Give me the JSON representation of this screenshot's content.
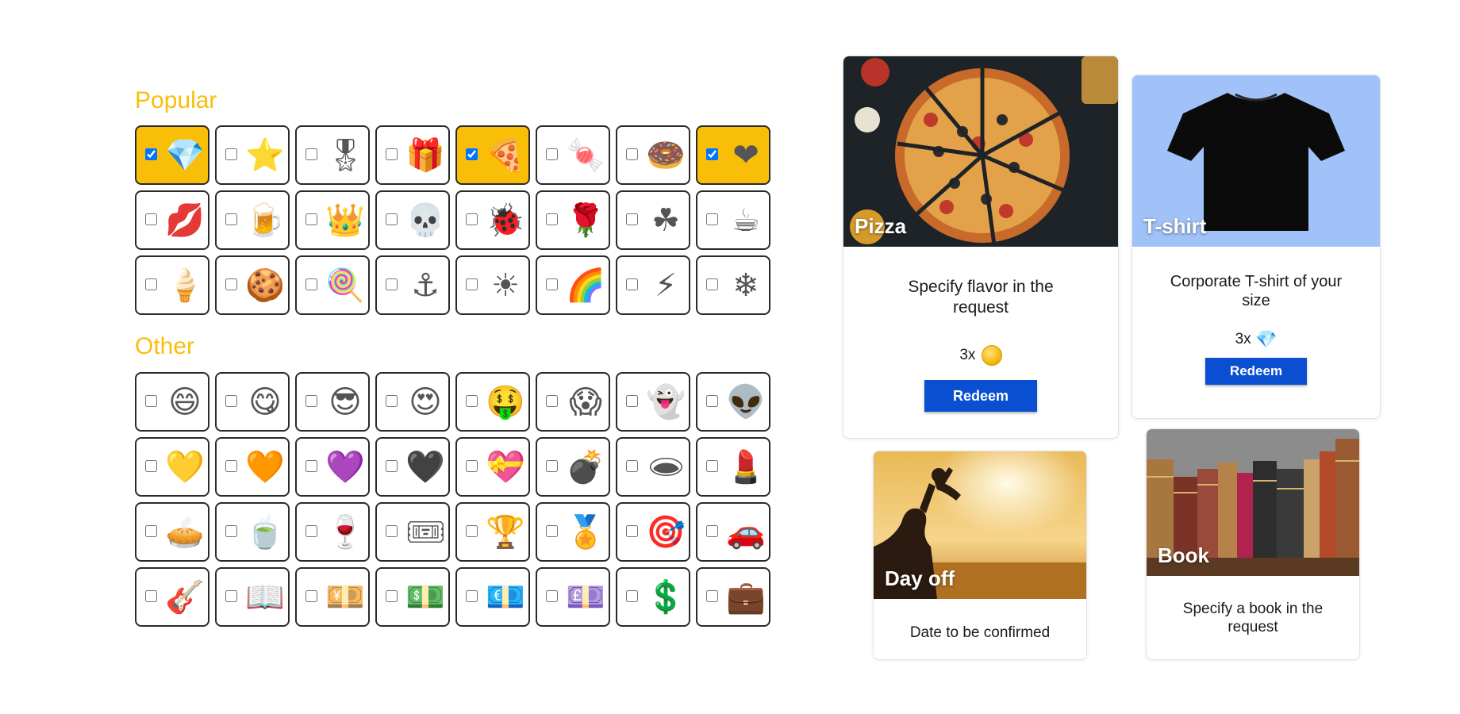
{
  "sections": {
    "popular_title": "Popular",
    "other_title": "Other"
  },
  "popular": [
    {
      "icon": "diamond-icon",
      "glyph": "💎",
      "checked": true
    },
    {
      "icon": "star-icon",
      "glyph": "⭐",
      "checked": false
    },
    {
      "icon": "medal-icon",
      "glyph": "🎖",
      "checked": false
    },
    {
      "icon": "gift-icon",
      "glyph": "🎁",
      "checked": false
    },
    {
      "icon": "pizza-icon",
      "glyph": "🍕",
      "checked": true
    },
    {
      "icon": "candy-icon",
      "glyph": "🍬",
      "checked": false
    },
    {
      "icon": "donut-icon",
      "glyph": "🍩",
      "checked": false
    },
    {
      "icon": "heart-icon",
      "glyph": "❤",
      "checked": true
    },
    {
      "icon": "kiss-icon",
      "glyph": "💋",
      "checked": false
    },
    {
      "icon": "beer-icon",
      "glyph": "🍺",
      "checked": false
    },
    {
      "icon": "crown-icon",
      "glyph": "👑",
      "checked": false
    },
    {
      "icon": "skull-icon",
      "glyph": "💀",
      "checked": false
    },
    {
      "icon": "ladybug-icon",
      "glyph": "🐞",
      "checked": false
    },
    {
      "icon": "rose-icon",
      "glyph": "🌹",
      "checked": false
    },
    {
      "icon": "shamrock-icon",
      "glyph": "☘",
      "checked": false
    },
    {
      "icon": "coffee-icon",
      "glyph": "☕",
      "checked": false
    },
    {
      "icon": "ice-cream-icon",
      "glyph": "🍦",
      "checked": false
    },
    {
      "icon": "cookie-icon",
      "glyph": "🍪",
      "checked": false
    },
    {
      "icon": "lollipop-icon",
      "glyph": "🍭",
      "checked": false
    },
    {
      "icon": "anchor-icon",
      "glyph": "⚓",
      "checked": false
    },
    {
      "icon": "sun-icon",
      "glyph": "☀",
      "checked": false
    },
    {
      "icon": "rainbow-icon",
      "glyph": "🌈",
      "checked": false
    },
    {
      "icon": "lightning-icon",
      "glyph": "⚡",
      "checked": false
    },
    {
      "icon": "snowflake-icon",
      "glyph": "❄",
      "checked": false
    }
  ],
  "other": [
    {
      "icon": "grinning-face-icon",
      "glyph": "😄",
      "checked": false
    },
    {
      "icon": "yum-face-icon",
      "glyph": "😋",
      "checked": false
    },
    {
      "icon": "sunglasses-face-icon",
      "glyph": "😎",
      "checked": false
    },
    {
      "icon": "heart-eyes-face-icon",
      "glyph": "😍",
      "checked": false
    },
    {
      "icon": "money-mouth-face-icon",
      "glyph": "🤑",
      "checked": false
    },
    {
      "icon": "screaming-face-icon",
      "glyph": "😱",
      "checked": false
    },
    {
      "icon": "ghost-icon",
      "glyph": "👻",
      "checked": false
    },
    {
      "icon": "alien-icon",
      "glyph": "👽",
      "checked": false
    },
    {
      "icon": "yellow-heart-icon",
      "glyph": "💛",
      "checked": false
    },
    {
      "icon": "orange-heart-icon",
      "glyph": "🧡",
      "checked": false
    },
    {
      "icon": "purple-heart-icon",
      "glyph": "💜",
      "checked": false
    },
    {
      "icon": "black-heart-icon",
      "glyph": "🖤",
      "checked": false
    },
    {
      "icon": "heart-ribbon-icon",
      "glyph": "💝",
      "checked": false
    },
    {
      "icon": "bomb-icon",
      "glyph": "💣",
      "checked": false
    },
    {
      "icon": "hole-icon",
      "glyph": "🕳",
      "checked": false
    },
    {
      "icon": "lipstick-icon",
      "glyph": "💄",
      "checked": false
    },
    {
      "icon": "pie-icon",
      "glyph": "🥧",
      "checked": false
    },
    {
      "icon": "tea-icon",
      "glyph": "🍵",
      "checked": false
    },
    {
      "icon": "wine-glass-icon",
      "glyph": "🍷",
      "checked": false
    },
    {
      "icon": "ticket-icon",
      "glyph": "🎟",
      "checked": false
    },
    {
      "icon": "trophy-icon",
      "glyph": "🏆",
      "checked": false
    },
    {
      "icon": "sports-medal-icon",
      "glyph": "🏅",
      "checked": false
    },
    {
      "icon": "target-icon",
      "glyph": "🎯",
      "checked": false
    },
    {
      "icon": "car-icon",
      "glyph": "🚗",
      "checked": false
    },
    {
      "icon": "guitar-icon",
      "glyph": "🎸",
      "checked": false
    },
    {
      "icon": "open-book-icon",
      "glyph": "📖",
      "checked": false
    },
    {
      "icon": "yen-banknote-icon",
      "glyph": "💴",
      "checked": false
    },
    {
      "icon": "dollar-banknote-icon",
      "glyph": "💵",
      "checked": false
    },
    {
      "icon": "euro-banknote-icon",
      "glyph": "💶",
      "checked": false
    },
    {
      "icon": "pound-banknote-icon",
      "glyph": "💷",
      "checked": false
    },
    {
      "icon": "dollar-sign-icon",
      "glyph": "💲",
      "checked": false
    },
    {
      "icon": "briefcase-icon",
      "glyph": "💼",
      "checked": false
    }
  ],
  "rewards": {
    "pizza": {
      "label": "Pizza",
      "description": "Specify flavor in the request",
      "cost": "3x",
      "cost_icon": "coin-icon",
      "button": "Redeem"
    },
    "tshirt": {
      "label": "T-shirt",
      "description": "Corporate T-shirt of your size",
      "cost": "3x",
      "cost_icon": "diamond-icon",
      "cost_glyph": "💎",
      "button": "Redeem"
    },
    "dayoff": {
      "label": "Day off",
      "description": "Date to be confirmed"
    },
    "book": {
      "label": "Book",
      "description": "Specify a book in the request"
    }
  },
  "colors": {
    "accent": "#f9bf08",
    "button": "#0a4fd1",
    "tshirt_bg": "#a0c2f9"
  }
}
